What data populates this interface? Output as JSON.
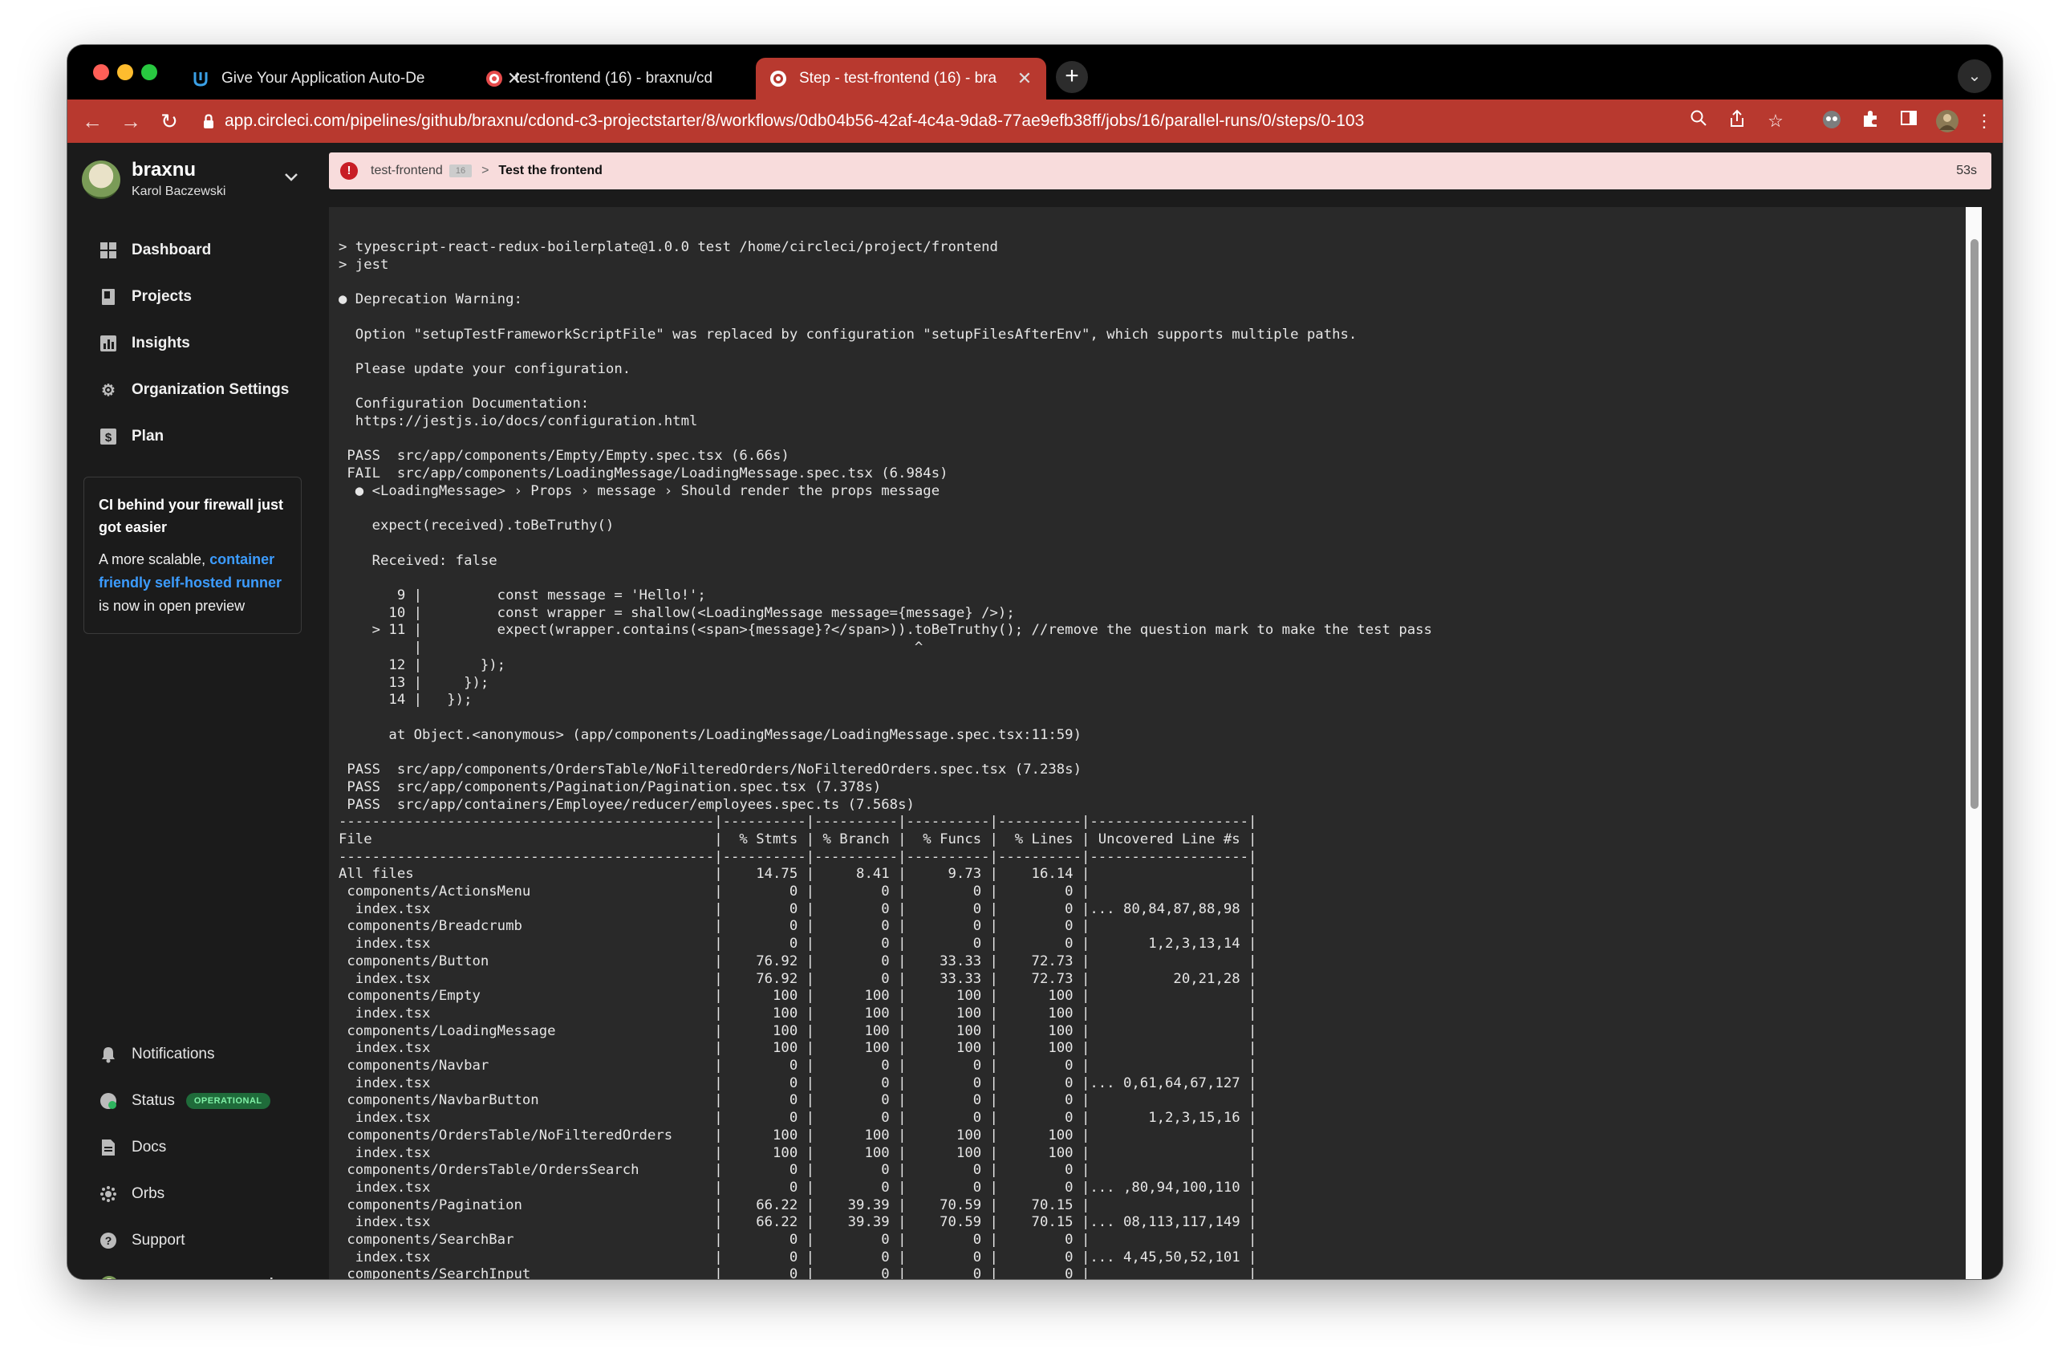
{
  "browser": {
    "tabs": [
      {
        "title": "Give Your Application Auto-De",
        "icon": "udacity-icon",
        "active": false
      },
      {
        "title": "test-frontend (16) - braxnu/cd",
        "icon": "circleci-icon",
        "active": false
      },
      {
        "title": "Step - test-frontend (16) - bra",
        "icon": "circleci-icon",
        "active": true
      }
    ],
    "close_glyph": "✕",
    "new_tab_glyph": "+",
    "url": "app.circleci.com/pipelines/github/braxnu/cdond-c3-projectstarter/8/workflows/0db04b56-42af-4c4a-9da8-77ae9efb38ff/jobs/16/parallel-runs/0/steps/0-103",
    "accent_color": "#b8392f"
  },
  "sidebar": {
    "org_name": "braxnu",
    "user_name": "Karol Baczewski",
    "items": [
      {
        "label": "Dashboard",
        "icon": "dashboard-icon"
      },
      {
        "label": "Projects",
        "icon": "projects-icon"
      },
      {
        "label": "Insights",
        "icon": "insights-icon"
      },
      {
        "label": "Organization Settings",
        "icon": "gear-icon"
      },
      {
        "label": "Plan",
        "icon": "dollar-icon"
      }
    ],
    "promo": {
      "title": "CI behind your firewall just got easier",
      "text_before": "A more scalable, ",
      "link": "container friendly self-hosted runner",
      "text_after": " is now in open preview"
    },
    "bottom_items": [
      {
        "label": "Notifications",
        "icon": "bell-icon"
      },
      {
        "label": "Status",
        "icon": "status-icon",
        "badge": "OPERATIONAL"
      },
      {
        "label": "Docs",
        "icon": "docs-icon"
      },
      {
        "label": "Orbs",
        "icon": "orbs-icon"
      },
      {
        "label": "Support",
        "icon": "help-icon"
      }
    ]
  },
  "step": {
    "job": "test-frontend",
    "job_number": "16",
    "separator": ">",
    "step_name": "Test the frontend",
    "duration": "53s",
    "status_color": "#c81d25"
  },
  "console": {
    "lines": [
      "> typescript-react-redux-boilerplate@1.0.0 test /home/circleci/project/frontend",
      "> jest",
      "",
      "● Deprecation Warning:",
      "",
      "  Option \"setupTestFrameworkScriptFile\" was replaced by configuration \"setupFilesAfterEnv\", which supports multiple paths.",
      "",
      "  Please update your configuration.",
      "",
      "  Configuration Documentation:",
      "  https://jestjs.io/docs/configuration.html",
      "",
      " PASS  src/app/components/Empty/Empty.spec.tsx (6.66s)",
      " FAIL  src/app/components/LoadingMessage/LoadingMessage.spec.tsx (6.984s)",
      "  ● <LoadingMessage> › Props › message › Should render the props message",
      "",
      "    expect(received).toBeTruthy()",
      "",
      "    Received: false",
      "",
      "       9 |         const message = 'Hello!';",
      "      10 |         const wrapper = shallow(<LoadingMessage message={message} />);",
      "    > 11 |         expect(wrapper.contains(<span>{message}?</span>)).toBeTruthy(); //remove the question mark to make the test pass",
      "         |                                                           ^",
      "      12 |       });",
      "      13 |     });",
      "      14 |   });",
      "",
      "      at Object.<anonymous> (app/components/LoadingMessage/LoadingMessage.spec.tsx:11:59)",
      "",
      " PASS  src/app/components/OrdersTable/NoFilteredOrders/NoFilteredOrders.spec.tsx (7.238s)",
      " PASS  src/app/components/Pagination/Pagination.spec.tsx (7.378s)",
      " PASS  src/app/containers/Employee/reducer/employees.spec.ts (7.568s)",
      "---------------------------------------------|----------|----------|----------|----------|-------------------|",
      "File                                         |  % Stmts | % Branch |  % Funcs |  % Lines | Uncovered Line #s |",
      "---------------------------------------------|----------|----------|----------|----------|-------------------|",
      "All files                                    |    14.75 |     8.41 |     9.73 |    16.14 |                   |",
      " components/ActionsMenu                      |        0 |        0 |        0 |        0 |                   |",
      "  index.tsx                                  |        0 |        0 |        0 |        0 |... 80,84,87,88,98 |",
      " components/Breadcrumb                       |        0 |        0 |        0 |        0 |                   |",
      "  index.tsx                                  |        0 |        0 |        0 |        0 |       1,2,3,13,14 |",
      " components/Button                           |    76.92 |        0 |    33.33 |    72.73 |                   |",
      "  index.tsx                                  |    76.92 |        0 |    33.33 |    72.73 |          20,21,28 |",
      " components/Empty                            |      100 |      100 |      100 |      100 |                   |",
      "  index.tsx                                  |      100 |      100 |      100 |      100 |                   |",
      " components/LoadingMessage                   |      100 |      100 |      100 |      100 |                   |",
      "  index.tsx                                  |      100 |      100 |      100 |      100 |                   |",
      " components/Navbar                           |        0 |        0 |        0 |        0 |                   |",
      "  index.tsx                                  |        0 |        0 |        0 |        0 |... 0,61,64,67,127 |",
      " components/NavbarButton                     |        0 |        0 |        0 |        0 |                   |",
      "  index.tsx                                  |        0 |        0 |        0 |        0 |       1,2,3,15,16 |",
      " components/OrdersTable/NoFilteredOrders     |      100 |      100 |      100 |      100 |                   |",
      "  index.tsx                                  |      100 |      100 |      100 |      100 |                   |",
      " components/OrdersTable/OrdersSearch         |        0 |        0 |        0 |        0 |                   |",
      "  index.tsx                                  |        0 |        0 |        0 |        0 |... ,80,94,100,110 |",
      " components/Pagination                       |    66.22 |    39.39 |    70.59 |    70.15 |                   |",
      "  index.tsx                                  |    66.22 |    39.39 |    70.59 |    70.15 |... 08,113,117,149 |",
      " components/SearchBar                        |        0 |        0 |        0 |        0 |                   |",
      "  index.tsx                                  |        0 |        0 |        0 |        0 |... 4,45,50,52,101 |",
      " components/SearchInput                      |        0 |        0 |        0 |        0 |                   |"
    ]
  }
}
